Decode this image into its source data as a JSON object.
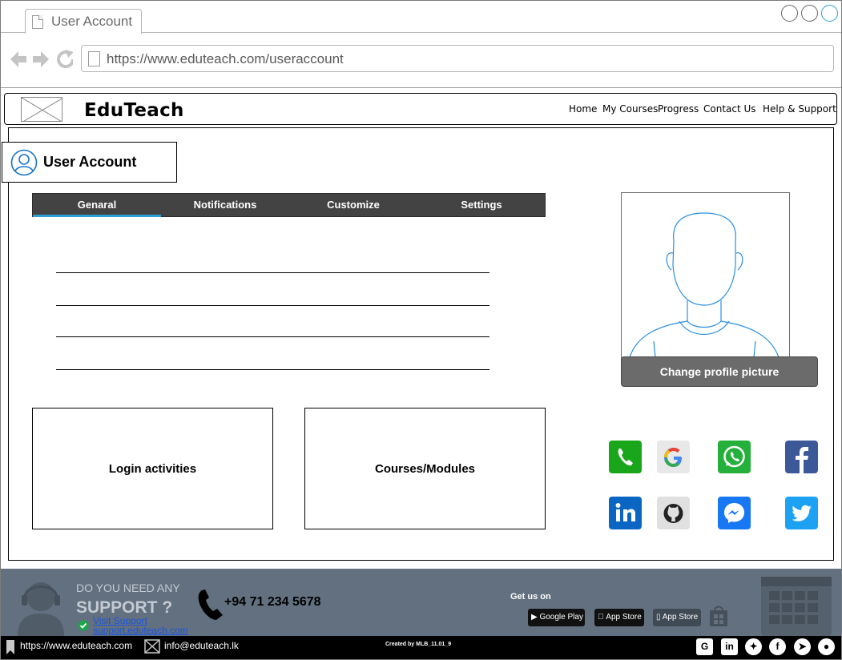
{
  "browser": {
    "tab_title": "User Account",
    "url": "https://www.eduteach.com/useraccount"
  },
  "header": {
    "brand": "EduTeach",
    "nav": [
      {
        "label": "Home"
      },
      {
        "label": "My Courses"
      },
      {
        "label": "Progress"
      },
      {
        "label": "Contact Us"
      },
      {
        "label": "Help & Support"
      }
    ]
  },
  "page": {
    "title": "User Account",
    "tabs": [
      {
        "label": "Genaral",
        "active": true
      },
      {
        "label": "Notifications",
        "active": false
      },
      {
        "label": "Customize",
        "active": false
      },
      {
        "label": "Settings",
        "active": false
      }
    ],
    "sections": {
      "login": "Login activities",
      "courses": "Courses/Modules"
    },
    "change_picture": "Change profile picture",
    "social_icons": [
      "phone-icon",
      "google-icon",
      "whatsapp-icon",
      "facebook-icon",
      "linkedin-icon",
      "github-icon",
      "messenger-icon",
      "twitter-icon"
    ]
  },
  "footer": {
    "support_q1": "DO YOU NEED ANY",
    "support_q2": "SUPPORT ?",
    "visit_support": "Visit Support",
    "support_url": "support.eduteach.com",
    "phone": "+94 71 234 5678",
    "get_us_on": "Get us on",
    "stores": {
      "google_play": "Google Play",
      "app_store_1": "App Store",
      "app_store_2": "App Store"
    },
    "website": "https://www.eduteach.com",
    "email": "info@eduteach.lk",
    "credit": "Created by MLB_11.01_9"
  },
  "colors": {
    "accent": "#2a9fd8",
    "tab_bar": "#434343",
    "footer_bg": "#62707f",
    "button_grey": "#6b6b6b"
  }
}
